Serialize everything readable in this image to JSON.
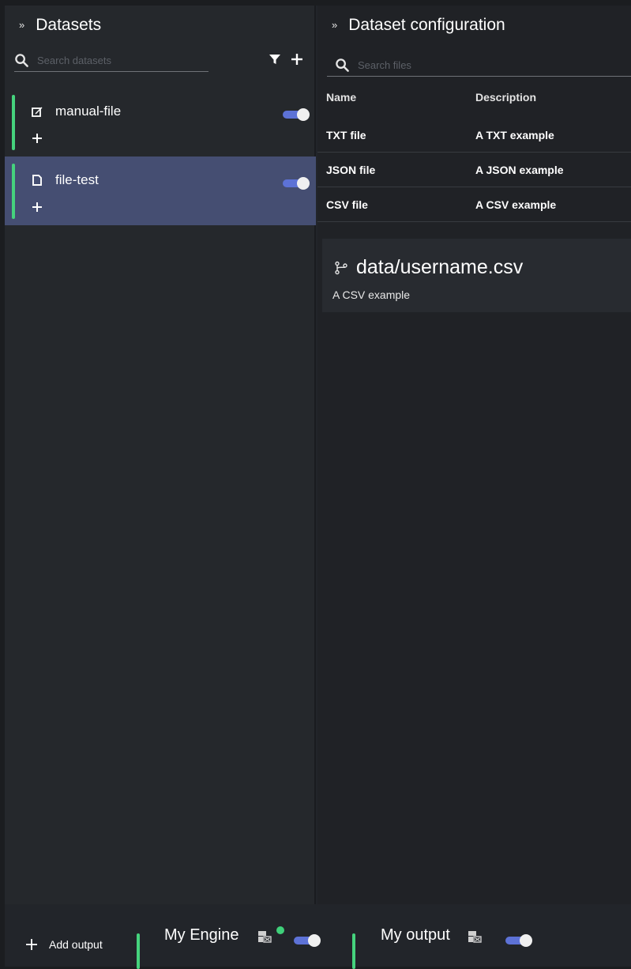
{
  "left_panel": {
    "title": "Datasets",
    "search_placeholder": "Search datasets",
    "items": [
      {
        "name": "manual-file",
        "icon": "edit-icon",
        "enabled": true,
        "selected": false
      },
      {
        "name": "file-test",
        "icon": "file-icon",
        "enabled": true,
        "selected": true
      }
    ]
  },
  "right_panel": {
    "title": "Dataset configuration",
    "search_placeholder": "Search files",
    "columns": [
      "Name",
      "Description"
    ],
    "rows": [
      {
        "name": "TXT file",
        "description": "A TXT example"
      },
      {
        "name": "JSON file",
        "description": "A JSON example"
      },
      {
        "name": "CSV file",
        "description": "A CSV example"
      }
    ],
    "detail": {
      "title": "data/username.csv",
      "description": "A CSV example",
      "icon": "branch-icon"
    }
  },
  "footer": {
    "add_output_label": "Add output",
    "outputs": [
      {
        "label": "My Engine",
        "icon": "engine-icon",
        "status": "online",
        "enabled": true
      },
      {
        "label": "My output",
        "icon": "engine-icon",
        "enabled": true
      }
    ]
  },
  "colors": {
    "accent_green": "#45d37d",
    "toggle_blue": "#5d72d6",
    "selected_row": "#454e72"
  }
}
